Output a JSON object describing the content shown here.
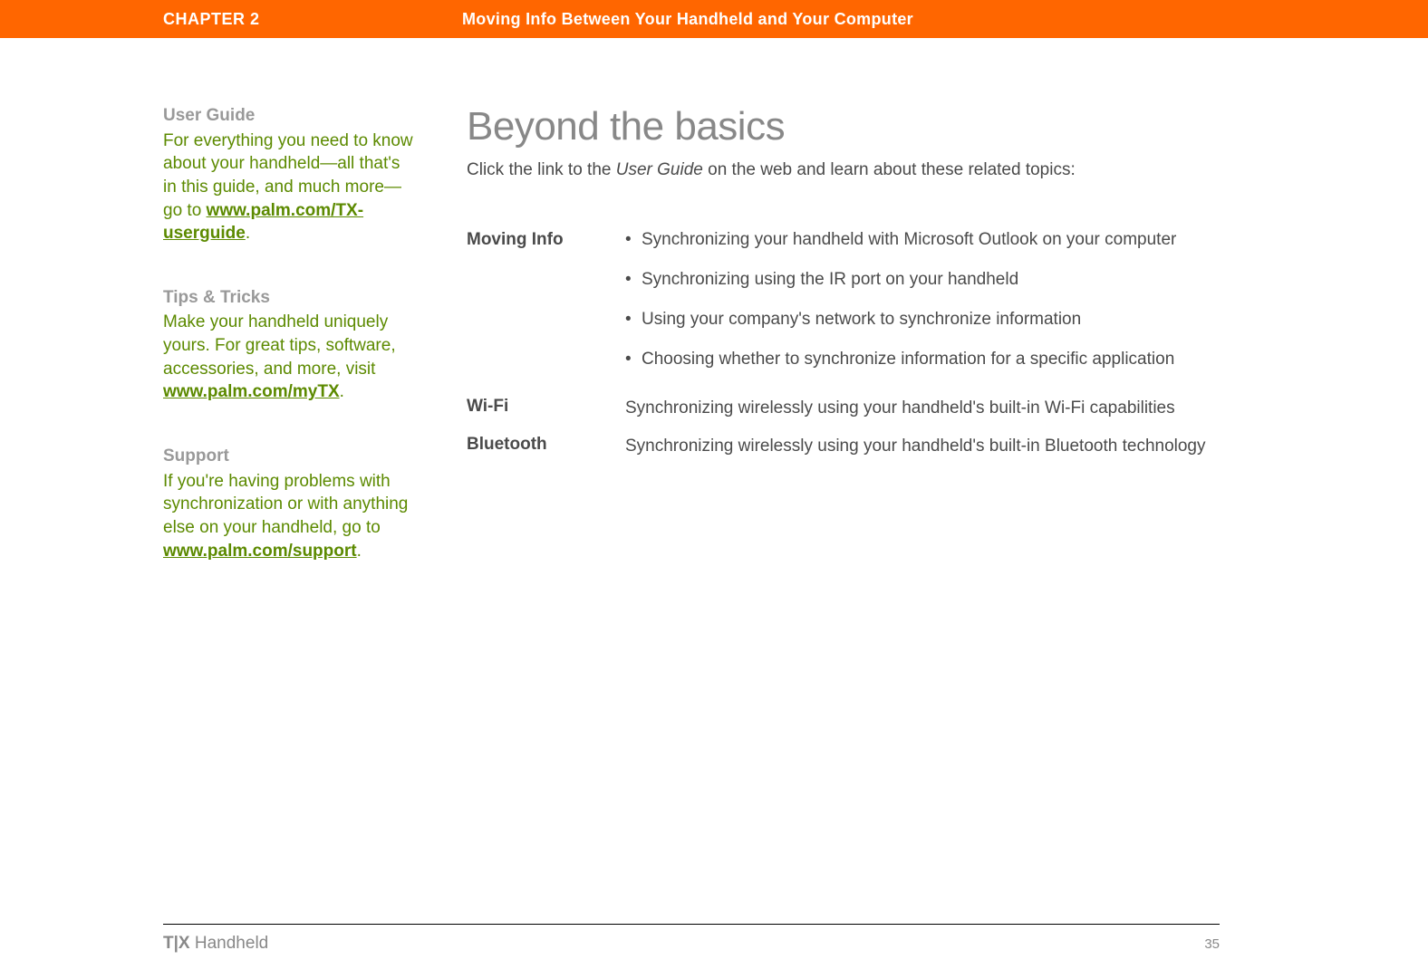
{
  "header": {
    "chapter": "CHAPTER 2",
    "title": "Moving Info Between Your Handheld and Your Computer"
  },
  "sidebar": {
    "blocks": [
      {
        "heading": "User Guide",
        "text_before_link": "For everything you need to know about your handheld—all that's in this guide, and much more—go to ",
        "link": "www.palm.com/TX-userguide",
        "text_after_link": "."
      },
      {
        "heading": "Tips & Tricks",
        "text_before_link": "Make your handheld uniquely yours. For great tips, software, accessories, and more, visit ",
        "link": "www.palm.com/myTX",
        "text_after_link": "."
      },
      {
        "heading": "Support",
        "text_before_link": "If you're having problems with synchronization or with anything else on your handheld, go to ",
        "link": "www.palm.com/support",
        "text_after_link": "."
      }
    ]
  },
  "main": {
    "heading": "Beyond the basics",
    "subhead_before_italic": "Click the link to the ",
    "subhead_italic": "User Guide",
    "subhead_after_italic": " on the web and learn about these related topics:",
    "topics": [
      {
        "label": "Moving Info",
        "type": "bullets",
        "items": [
          "Synchronizing your handheld with Microsoft Outlook on your computer",
          "Synchronizing using the IR port on your handheld",
          "Using your company's network to synchronize information",
          "Choosing whether to synchronize information for a specific application"
        ]
      },
      {
        "label": "Wi-Fi",
        "type": "plain",
        "text": "Synchronizing wirelessly using your handheld's built-in Wi-Fi capabilities"
      },
      {
        "label": "Bluetooth",
        "type": "plain",
        "text": "Synchronizing wirelessly using your handheld's built-in Bluetooth technology"
      }
    ]
  },
  "footer": {
    "product_bold": "T|X",
    "product_rest": " Handheld",
    "page_number": "35"
  }
}
